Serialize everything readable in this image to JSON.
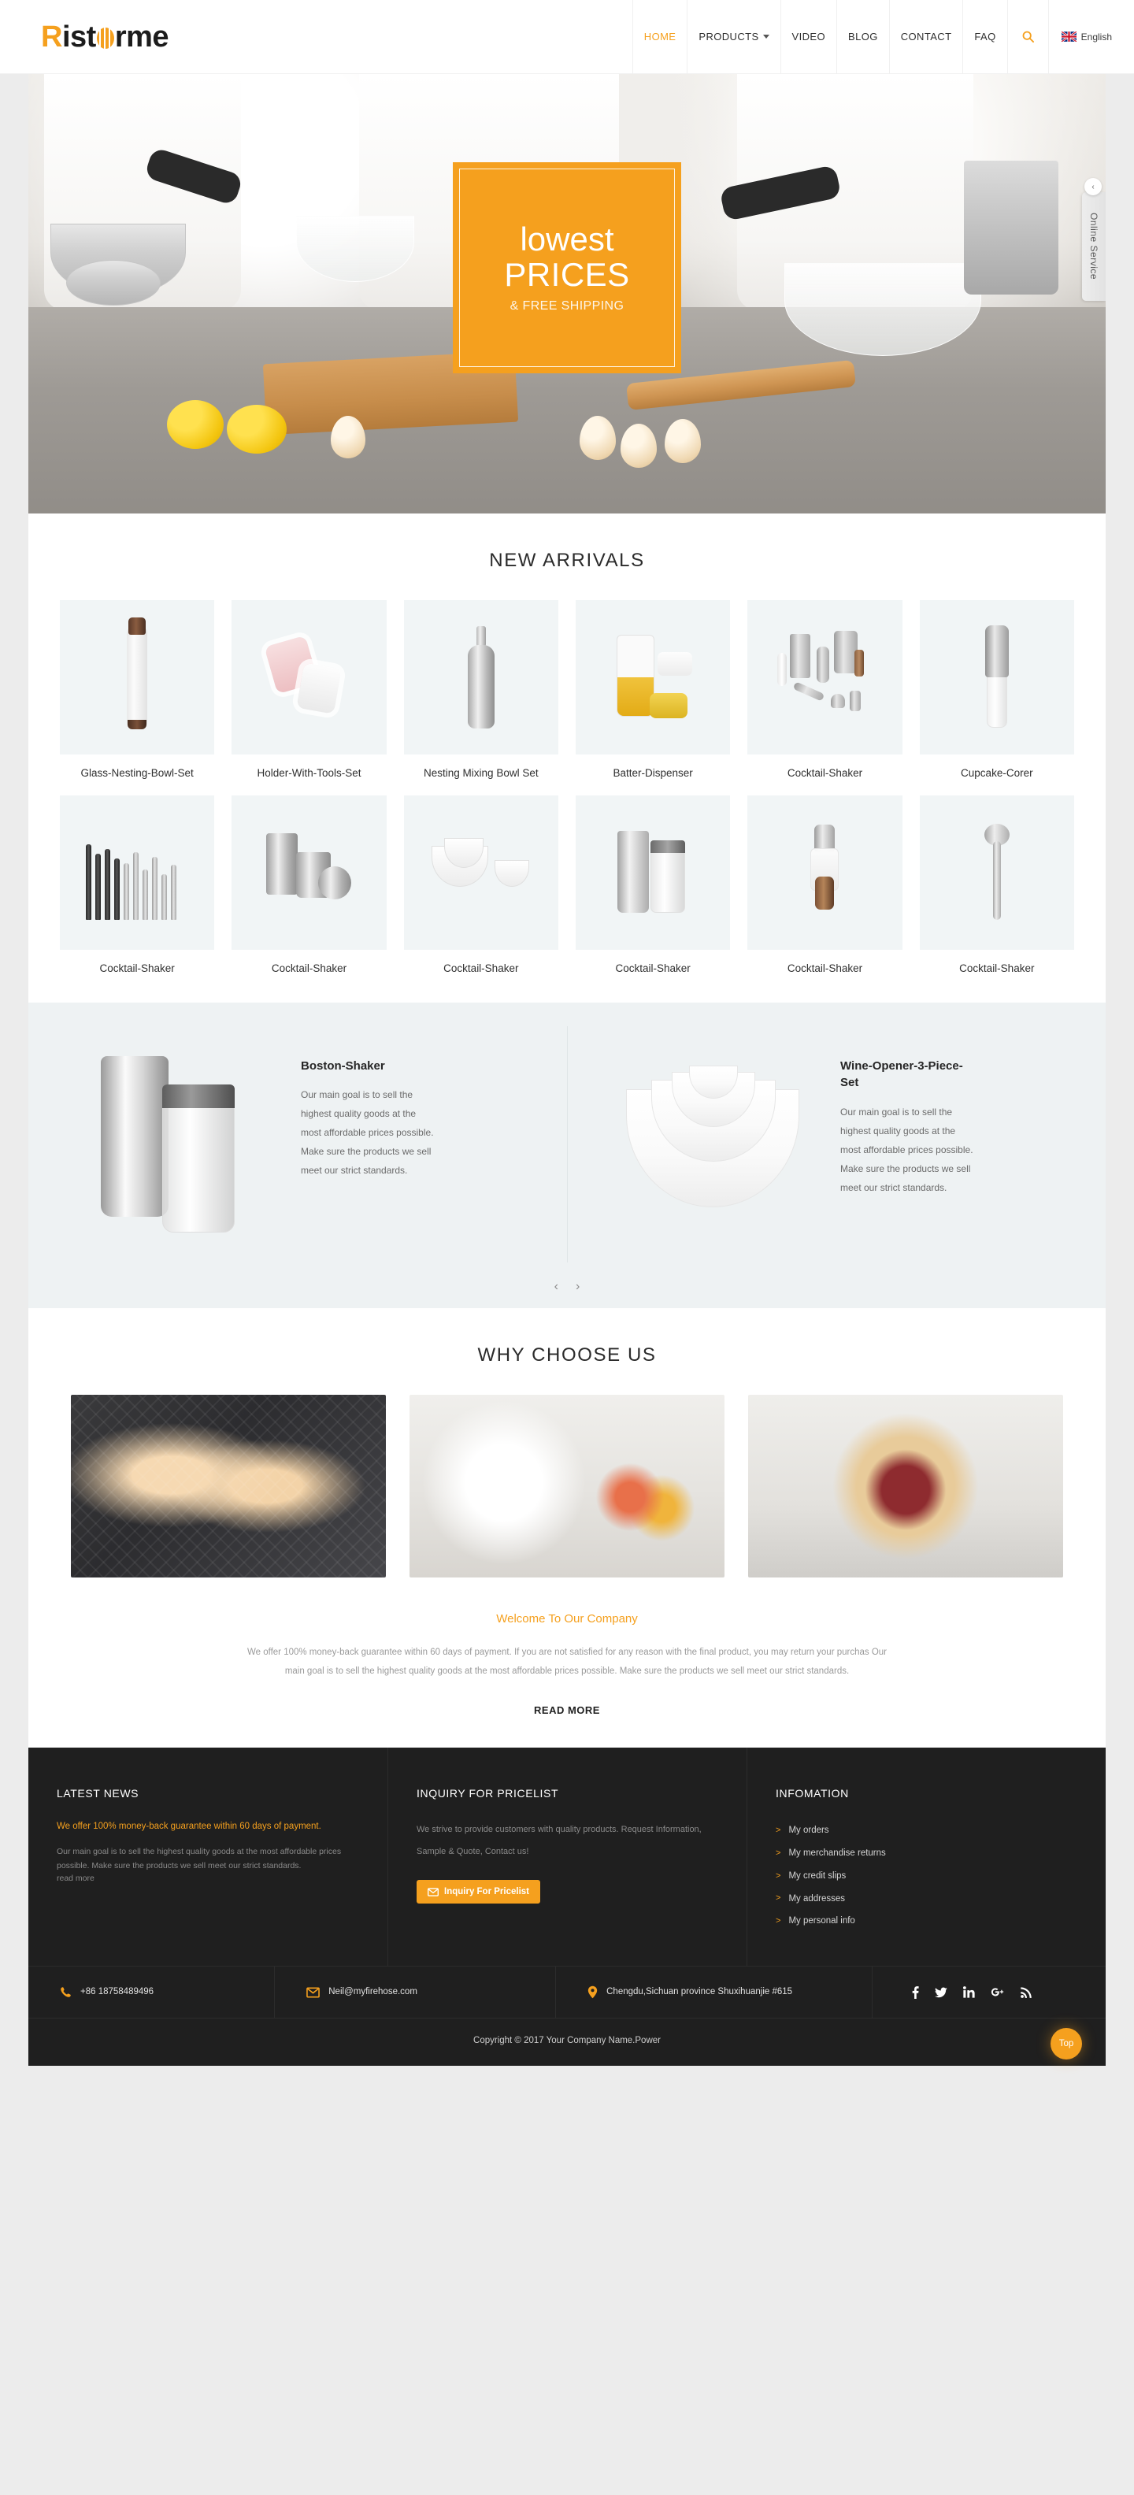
{
  "header": {
    "logo": {
      "first": "R",
      "middle": "ist",
      "orb": "o",
      "last": "rme"
    },
    "nav": [
      {
        "label": "HOME",
        "active": true,
        "caret": false
      },
      {
        "label": "PRODUCTS",
        "active": false,
        "caret": true
      },
      {
        "label": "VIDEO",
        "active": false,
        "caret": false
      },
      {
        "label": "BLOG",
        "active": false,
        "caret": false
      },
      {
        "label": "CONTACT",
        "active": false,
        "caret": false
      },
      {
        "label": "FAQ",
        "active": false,
        "caret": false
      }
    ],
    "search_icon": "search-icon",
    "language": {
      "label": "English",
      "flag": "uk-flag"
    }
  },
  "hero": {
    "line1": "lowest",
    "line2": "PRICES",
    "line3": "& FREE SHIPPING",
    "online_service": "Online Service",
    "online_service_chevron": "‹"
  },
  "new_arrivals": {
    "title": "NEW ARRIVALS",
    "row1": [
      {
        "name": "Glass-Nesting-Bowl-Set",
        "glyph": "bottle"
      },
      {
        "name": "Holder-With-Tools-Set",
        "glyph": "holder"
      },
      {
        "name": "Nesting Mixing Bowl Set",
        "glyph": "shaker"
      },
      {
        "name": "Batter-Dispenser",
        "glyph": "batter"
      },
      {
        "name": "Cocktail-Shaker",
        "glyph": "set"
      },
      {
        "name": "Cupcake-Corer",
        "glyph": "corer"
      }
    ],
    "row2": [
      {
        "name": "Cocktail-Shaker",
        "glyph": "utensils"
      },
      {
        "name": "Cocktail-Shaker",
        "glyph": "tins"
      },
      {
        "name": "Cocktail-Shaker",
        "glyph": "bowls"
      },
      {
        "name": "Cocktail-Shaker",
        "glyph": "cups"
      },
      {
        "name": "Cocktail-Shaker",
        "glyph": "pepper"
      },
      {
        "name": "Cocktail-Shaker",
        "glyph": "scoop"
      }
    ]
  },
  "featured": {
    "items": [
      {
        "title": "Boston-Shaker",
        "desc": "Our main goal is to sell the highest quality goods at the most affordable prices possible. Make sure the products we sell meet our strict standards."
      },
      {
        "title": "Wine-Opener-3-Piece-Set",
        "desc": "Our main goal is to sell the highest quality goods at the most affordable prices possible. Make sure the products we sell meet our strict standards."
      }
    ],
    "prev": "‹",
    "next": "›"
  },
  "why_choose_us": {
    "title": "WHY CHOOSE US",
    "images": [
      "pastry-photo",
      "toaster-breakfast-photo",
      "galette-pie-photo"
    ],
    "welcome_title": "Welcome To Our Company",
    "welcome_body": "We offer 100% money-back guarantee within 60 days of payment. If you are not satisfied for any reason with the final product, you may return your purchas Our main goal is to sell the highest quality goods at the most affordable prices possible. Make sure the products we sell meet our strict standards.",
    "read_more": "READ MORE"
  },
  "footer": {
    "latest_news": {
      "heading": "LATEST NEWS",
      "headline": "We offer 100% money-back guarantee within 60 days of payment.",
      "body": "Our main goal is to sell the highest quality goods at the most affordable prices possible. Make sure the products we sell meet our strict standards.",
      "read_more": "read more"
    },
    "inquiry": {
      "heading": "INQUIRY FOR PRICELIST",
      "body": "We strive to provide customers with quality products. Request Information, Sample & Quote, Contact us!",
      "button": "Inquiry For Pricelist",
      "button_icon": "envelope-icon"
    },
    "information": {
      "heading": "INFOMATION",
      "items": [
        "My orders",
        "My merchandise returns",
        "My credit slips",
        "My addresses",
        "My personal info"
      ]
    },
    "contact": {
      "phone": "+86 18758489496",
      "email": "Neil@myfirehose.com",
      "address": "Chengdu,Sichuan province Shuxihuanjie #615",
      "socials": [
        "facebook-icon",
        "twitter-icon",
        "linkedin-icon",
        "google-plus-icon",
        "rss-icon"
      ]
    },
    "copyright": "Copyright © 2017 Your Company Name.Power",
    "top_button": "Top"
  },
  "colors": {
    "accent": "#f5a01e",
    "footer_bg": "#1f1f1f",
    "page_bg": "#ececec",
    "thumb_bg": "#f1f5f6"
  }
}
